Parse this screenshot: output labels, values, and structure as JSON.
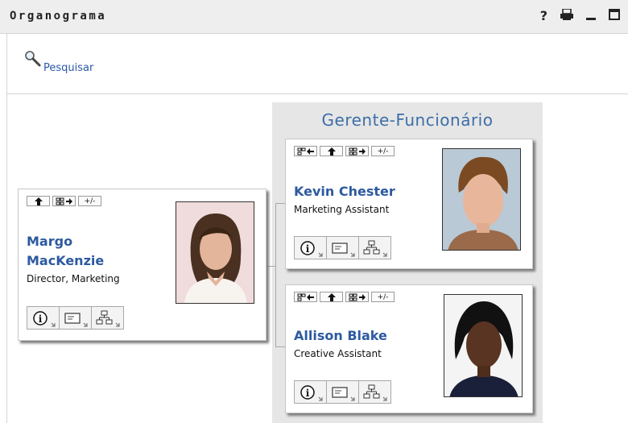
{
  "window": {
    "title": "Organograma",
    "controls": [
      "?",
      "print",
      "_",
      "□"
    ]
  },
  "search": {
    "label": "Pesquisar"
  },
  "panel": {
    "title": "Gerente-Funcionário"
  },
  "cards": {
    "manager": {
      "first_name": "Margo",
      "last_name": "MacKenzie",
      "role": "Director, Marketing"
    },
    "kevin": {
      "name": "Kevin Chester",
      "role": "Marketing Assistant"
    },
    "allison": {
      "name": "Allison Blake",
      "role": "Creative Assistant"
    }
  },
  "button_labels": {
    "expand_collapse": "+/-"
  },
  "colors": {
    "name_blue": "#2d5aa0",
    "panel_bg": "#e6e6e6",
    "title_blue": "#3c6ea8"
  }
}
